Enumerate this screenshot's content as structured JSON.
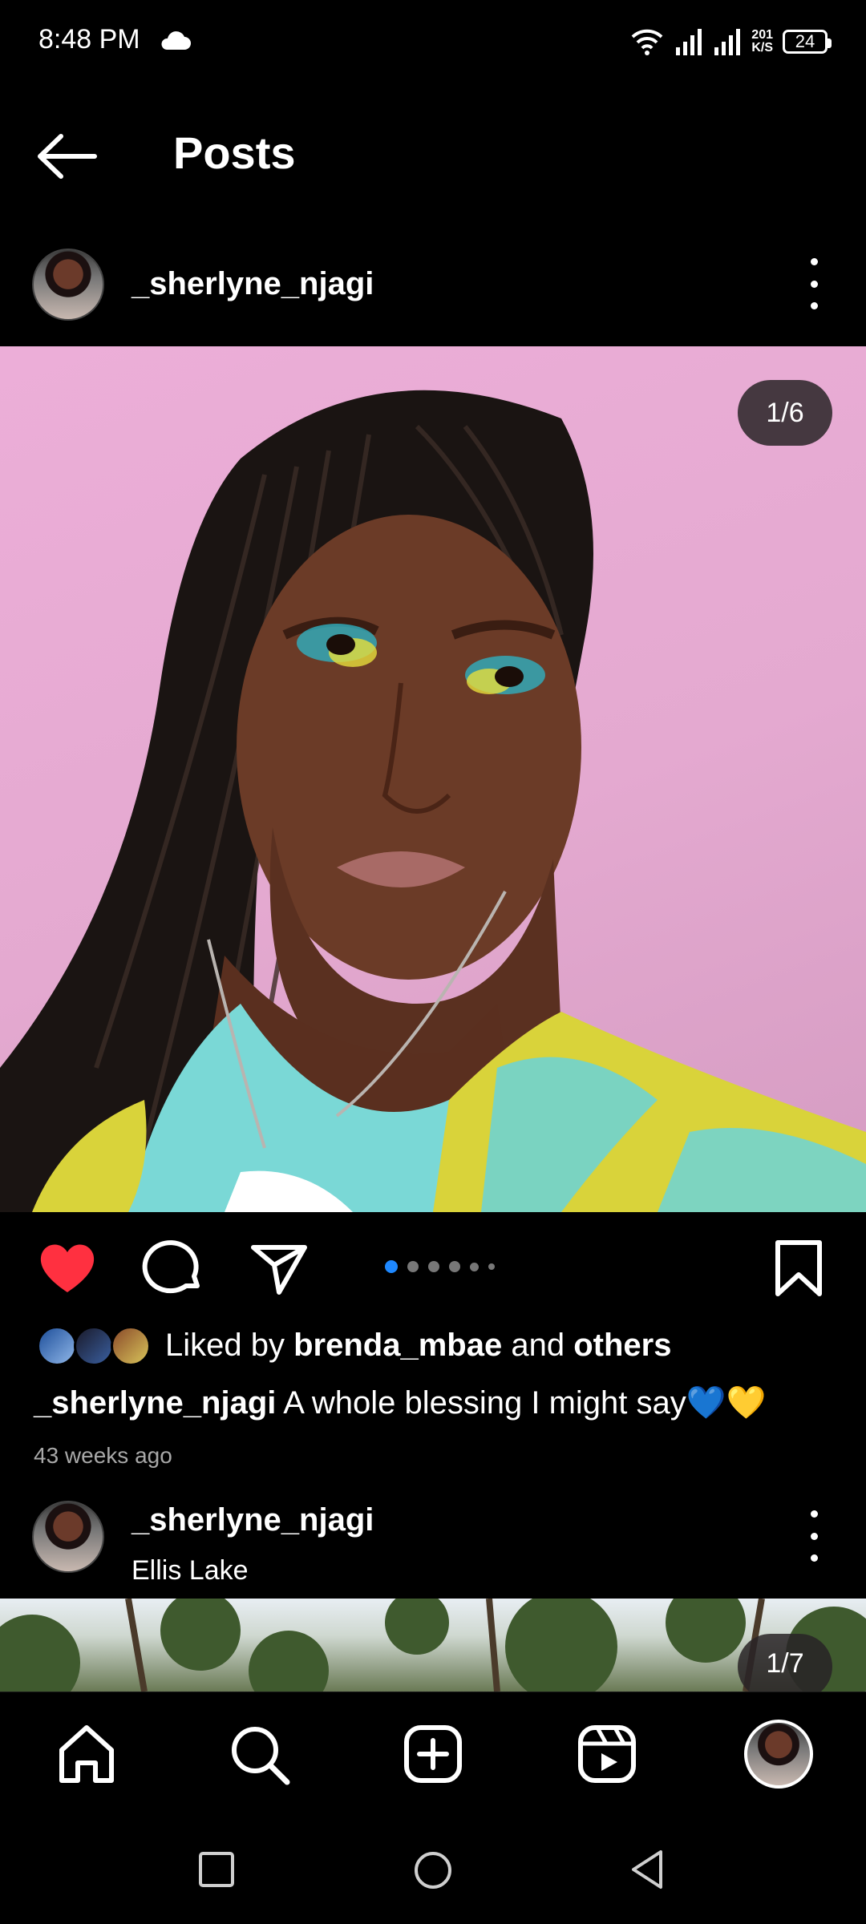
{
  "status_bar": {
    "time": "8:48 PM",
    "net_speed_value": "201",
    "net_speed_unit": "K/S",
    "battery": "24",
    "icons": [
      "cloud-icon",
      "wifi-icon",
      "signal-icon",
      "signal-icon",
      "battery-icon"
    ]
  },
  "header": {
    "title": "Posts"
  },
  "post": {
    "username": "_sherlyne_njagi",
    "counter": "1/6",
    "carousel_total": 6,
    "carousel_active": 1,
    "liked": true,
    "likes": {
      "prefix": "Liked by",
      "user": "brenda_mbae",
      "middle": "and",
      "others": "others"
    },
    "caption_user": "_sherlyne_njagi",
    "caption_text": "A whole blessing I might say💙💛",
    "timestamp": "43 weeks ago"
  },
  "next_post": {
    "username": "_sherlyne_njagi",
    "location": "Ellis Lake",
    "counter": "1/7"
  },
  "bottom_nav": [
    "home-icon",
    "search-icon",
    "create-icon",
    "reels-icon",
    "profile-avatar"
  ],
  "colors": {
    "accent_blue": "#1e88ff",
    "like_red": "#ff3040",
    "background": "#000000"
  }
}
